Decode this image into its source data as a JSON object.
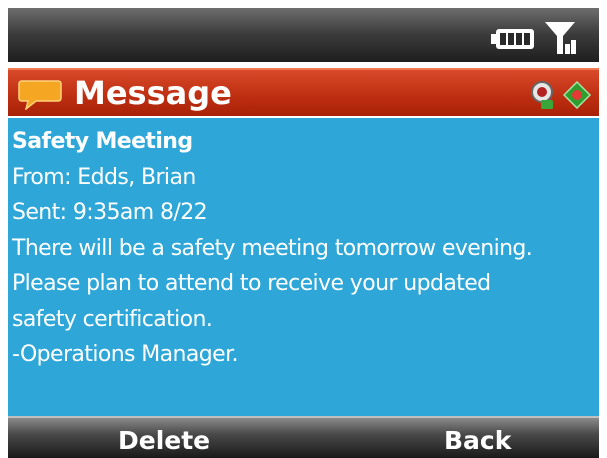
{
  "titlebar": {
    "title": "Message",
    "accent_color": "#bf2f12",
    "icons": [
      "message-bubble-icon",
      "high-priority-icon",
      "navigation-icon"
    ]
  },
  "statusbar": {
    "icons": [
      "battery-icon",
      "signal-icon"
    ]
  },
  "message": {
    "subject": "Safety Meeting",
    "from": "From: Edds, Brian",
    "sent": "Sent: 9:35am 8/22",
    "body_lines": [
      "There will be a safety meeting tomorrow evening.",
      "Please plan to attend to receive your updated",
      "safety certification.",
      "-Operations Manager."
    ],
    "background_color": "#2ea7d8"
  },
  "softkeys": {
    "left": "Delete",
    "right": "Back"
  }
}
